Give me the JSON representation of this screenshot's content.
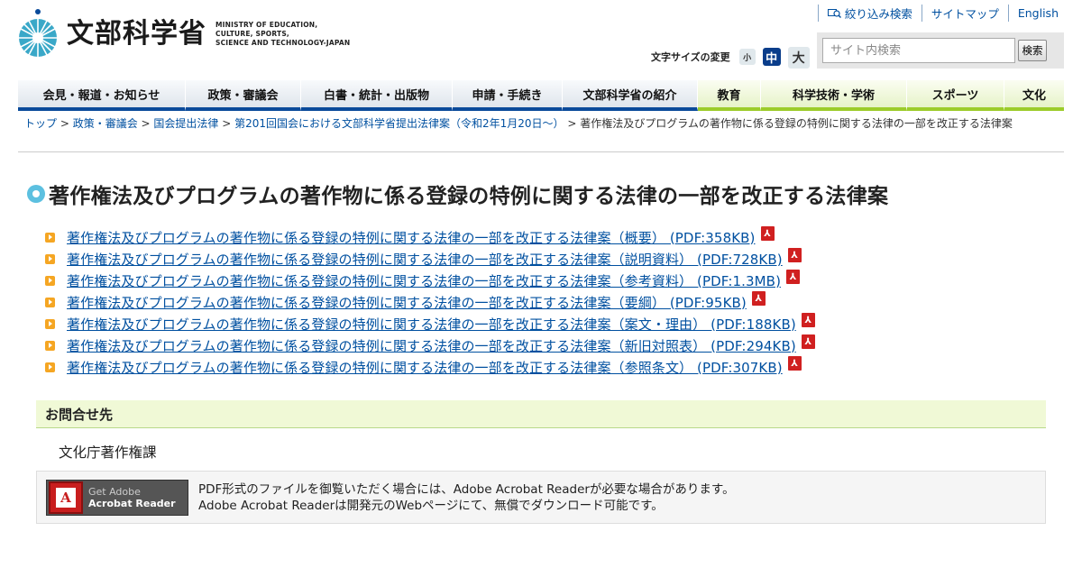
{
  "header": {
    "logo_ja": "文部科学省",
    "logo_en": [
      "MINISTRY OF EDUCATION,",
      "CULTURE, SPORTS,",
      "SCIENCE AND TECHNOLOGY-JAPAN"
    ],
    "util_links": [
      "絞り込み検索",
      "サイトマップ",
      "English"
    ],
    "fontsize_label": "文字サイズの変更",
    "fontsize_small": "小",
    "fontsize_medium": "中",
    "fontsize_large": "大",
    "search_placeholder": "サイト内検索",
    "search_button": "検索"
  },
  "nav": [
    {
      "label": "会見・報道・お知らせ",
      "theme": "blue"
    },
    {
      "label": "政策・審議会",
      "theme": "blue"
    },
    {
      "label": "白書・統計・出版物",
      "theme": "blue"
    },
    {
      "label": "申請・手続き",
      "theme": "blue"
    },
    {
      "label": "文部科学省の紹介",
      "theme": "blue"
    },
    {
      "label": "教育",
      "theme": "green"
    },
    {
      "label": "科学技術・学術",
      "theme": "green"
    },
    {
      "label": "スポーツ",
      "theme": "green"
    },
    {
      "label": "文化",
      "theme": "green"
    }
  ],
  "breadcrumb": {
    "links": [
      "トップ",
      "政策・審議会",
      "国会提出法律",
      "第201回国会における文部科学省提出法律案（令和2年1月20日～）"
    ],
    "current": "著作権法及びプログラムの著作物に係る登録の特例に関する法律の一部を改正する法律案"
  },
  "title": "著作権法及びプログラムの著作物に係る登録の特例に関する法律の一部を改正する法律案",
  "documents": [
    "著作権法及びプログラムの著作物に係る登録の特例に関する法律の一部を改正する法律案（概要） (PDF:358KB)",
    "著作権法及びプログラムの著作物に係る登録の特例に関する法律の一部を改正する法律案（説明資料） (PDF:728KB)",
    "著作権法及びプログラムの著作物に係る登録の特例に関する法律の一部を改正する法律案（参考資料） (PDF:1.3MB)",
    "著作権法及びプログラムの著作物に係る登録の特例に関する法律の一部を改正する法律案（要綱） (PDF:95KB)",
    "著作権法及びプログラムの著作物に係る登録の特例に関する法律の一部を改正する法律案（案文・理由） (PDF:188KB)",
    "著作権法及びプログラムの著作物に係る登録の特例に関する法律の一部を改正する法律案（新旧対照表） (PDF:294KB)",
    "著作権法及びプログラムの著作物に係る登録の特例に関する法律の一部を改正する法律案（参照条文） (PDF:307KB)"
  ],
  "contact": {
    "heading": "お問合せ先",
    "body": "文化庁著作権課"
  },
  "acrobat": {
    "get": "Get Adobe",
    "name": "Acrobat Reader",
    "desc1": "PDF形式のファイルを御覧いただく場合には、Adobe Acrobat Readerが必要な場合があります。",
    "desc2": "Adobe Acrobat Readerは開発元のWebページにて、無償でダウンロード可能です。"
  },
  "colors": {
    "link": "#0050a0",
    "nav_blue": "#0a4a9a",
    "nav_green": "#9ccc2a",
    "pdf_icon": "#d02020",
    "bullet": "#f5a623"
  }
}
